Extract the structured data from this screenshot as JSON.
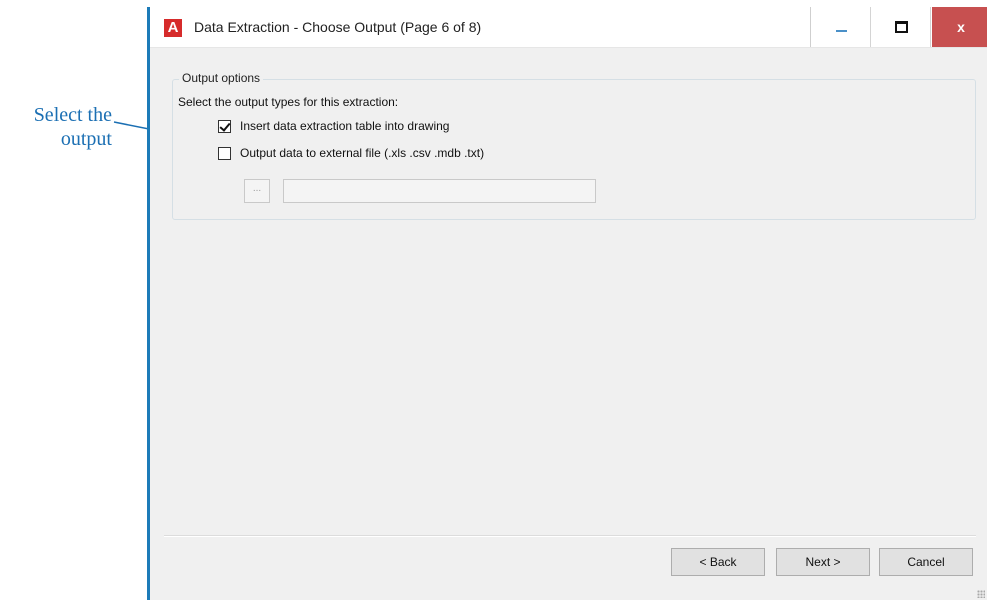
{
  "annotation": {
    "callout_lines": [
      "Select the",
      "output"
    ],
    "color": "#1b6fb3"
  },
  "window": {
    "app_icon": "autocad-logo-icon",
    "app_icon_letter": "A",
    "title": "Data Extraction - Choose Output (Page 6 of 8)",
    "controls": {
      "minimize": "minimize-icon",
      "maximize": "maximize-icon",
      "close": "close-icon",
      "close_glyph": "x"
    },
    "accent_color": "#1c7bb8",
    "close_color": "#c75050"
  },
  "output_options": {
    "legend": "Output options",
    "instruction": "Select the output types for this extraction:",
    "options": [
      {
        "label": "Insert data extraction table into drawing",
        "checked": true
      },
      {
        "label": "Output data to external file (.xls .csv .mdb .txt)",
        "checked": false
      }
    ],
    "browse_button_label": "...",
    "file_path_value": ""
  },
  "footer": {
    "back_label": "< Back",
    "next_label": "Next >",
    "cancel_label": "Cancel"
  }
}
